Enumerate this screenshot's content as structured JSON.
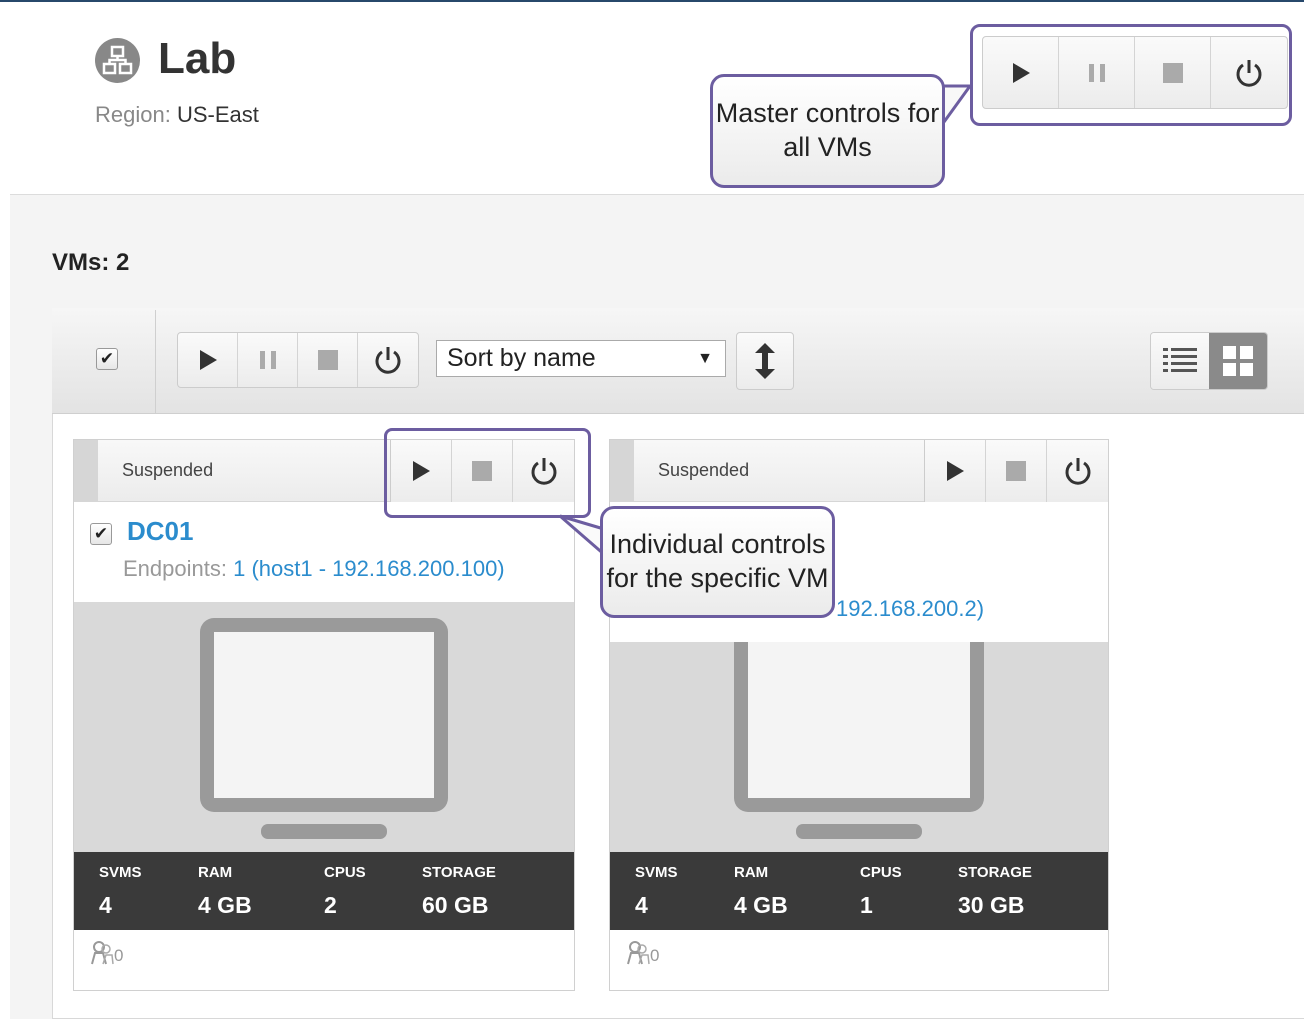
{
  "lab": {
    "title": "Lab",
    "region_label": "Region:",
    "region_value": "US-East"
  },
  "master_controls": {
    "buttons": [
      "play-icon",
      "pause-icon",
      "stop-icon",
      "power-icon"
    ],
    "callout": "Master controls for all VMs"
  },
  "vms_label": "VMs: 2",
  "toolbar": {
    "select_all_checked": true,
    "buttons": [
      "play-icon",
      "pause-icon",
      "stop-icon",
      "power-icon"
    ],
    "sort_value": "Sort by name",
    "sort_direction_icon": "sort-updown-icon",
    "view_modes": [
      "list-view-icon",
      "grid-view-icon"
    ],
    "active_view": "grid"
  },
  "vm_callout": "Individual controls for the specific VM",
  "vms": [
    {
      "status": "Suspended",
      "name": "DC01",
      "endpoints_label": "Endpoints:",
      "endpoints_value": "1 (host1 - 192.168.200.100)",
      "stats": [
        {
          "key": "SVMS",
          "value": "4"
        },
        {
          "key": "RAM",
          "value": "4 GB"
        },
        {
          "key": "CPUS",
          "value": "2"
        },
        {
          "key": "STORAGE",
          "value": "60 GB"
        }
      ],
      "footer_count": "0"
    },
    {
      "status": "Suspended",
      "name": "",
      "endpoints_label": "",
      "endpoints_value": "192.168.200.2)",
      "stats": [
        {
          "key": "SVMS",
          "value": "4"
        },
        {
          "key": "RAM",
          "value": "4 GB"
        },
        {
          "key": "CPUS",
          "value": "1"
        },
        {
          "key": "STORAGE",
          "value": "30 GB"
        }
      ],
      "footer_count": "0"
    }
  ],
  "colors": {
    "accent_blue": "#2b8ccd",
    "callout_border": "#6c5da0",
    "stats_bg": "#3a3a3a"
  }
}
